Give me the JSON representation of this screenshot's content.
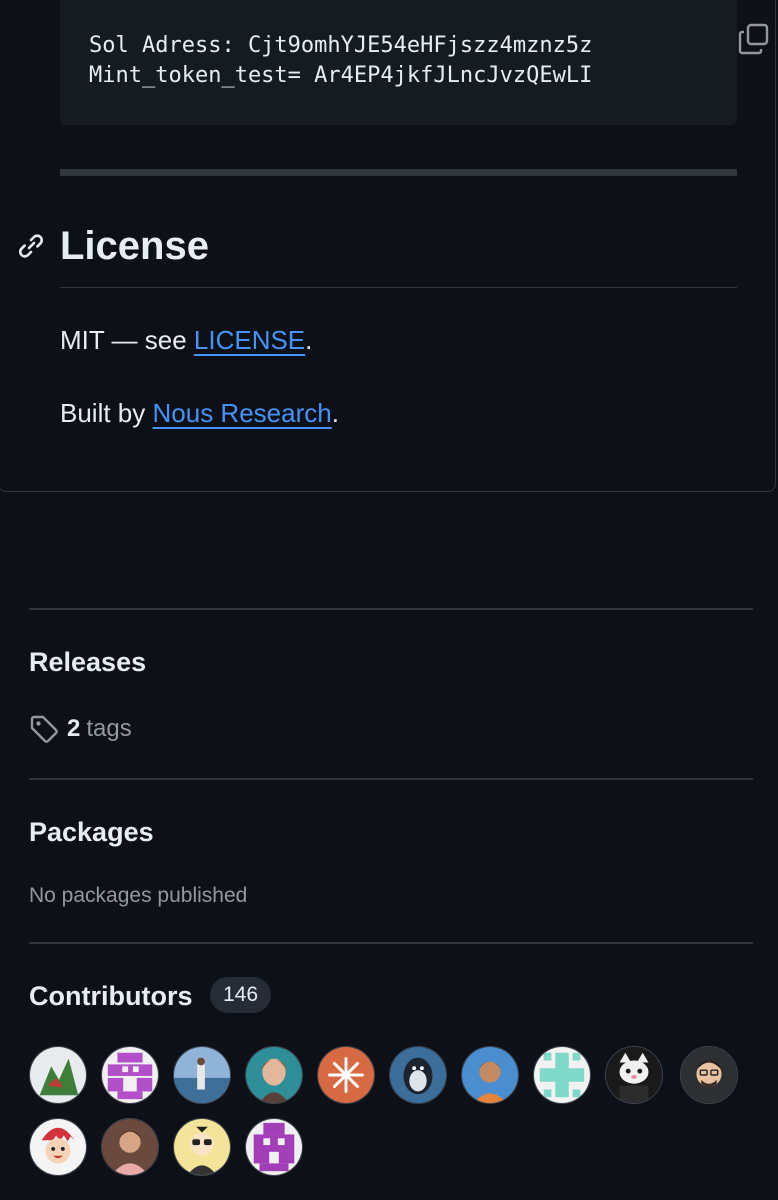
{
  "readme": {
    "code_lines": [
      "Sol Adress: Cjt9omhYJE54eHFjszz4mznz5z",
      "Mint_token_test= Ar4EP4jkfJLncJvzQEwLI"
    ],
    "license_heading": "License",
    "license_prefix": "MIT — see ",
    "license_link": "LICENSE",
    "license_suffix": ".",
    "built_prefix": "Built by ",
    "built_link": "Nous Research",
    "built_suffix": "."
  },
  "sidebar": {
    "releases_title": "Releases",
    "tags_count": "2",
    "tags_label": "tags",
    "packages_title": "Packages",
    "packages_empty": "No packages published",
    "contributors_title": "Contributors",
    "contributors_count": "146"
  },
  "colors": {
    "background": "#0d1117",
    "border": "#30363d",
    "link": "#4493f8",
    "muted": "#9198a1"
  },
  "contributor_avatars": [
    "avatar-1",
    "avatar-2",
    "avatar-3",
    "avatar-4",
    "avatar-5",
    "avatar-6",
    "avatar-7",
    "avatar-8",
    "avatar-9",
    "avatar-10",
    "avatar-11",
    "avatar-12",
    "avatar-13",
    "avatar-14"
  ]
}
